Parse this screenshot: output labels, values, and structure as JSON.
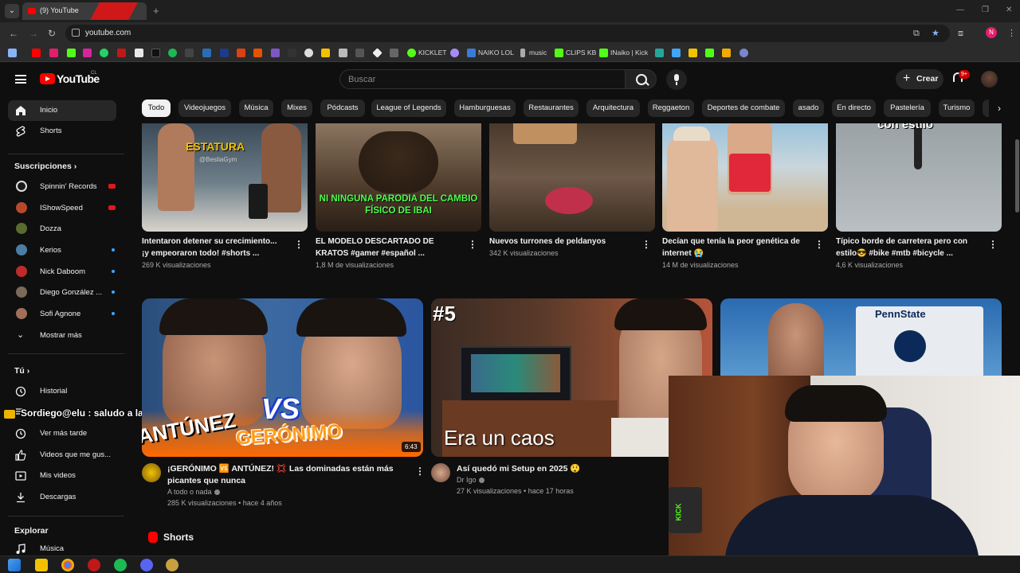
{
  "browser": {
    "tab_title": "(9) YouTube",
    "url": "youtube.com",
    "profile_initial": "N",
    "bookmarks": [
      {
        "label": "KICKLET",
        "icon": "kick-icon",
        "color": "#53fc18"
      },
      {
        "label": "NAIKO LOL",
        "icon": "bookmark-l-icon",
        "color": "#3a7bd5"
      },
      {
        "label": "music",
        "icon": "music-icon",
        "color": "#cccccc"
      },
      {
        "label": "CLIPS KB",
        "icon": "clips-icon",
        "color": "#53fc18"
      },
      {
        "label": "INaiko | Kick",
        "icon": "kick-icon",
        "color": "#53fc18"
      }
    ]
  },
  "masthead": {
    "logo_text": "YouTube",
    "country_code": "CL",
    "search_placeholder": "Buscar",
    "create_label": "Crear",
    "notifications_count": "9+"
  },
  "chips": [
    "Todo",
    "Videojuegos",
    "Música",
    "Mixes",
    "Pódcasts",
    "League of Legends",
    "Hamburguesas",
    "Restaurantes",
    "Arquitectura",
    "Reggaeton",
    "Deportes de combate",
    "asado",
    "En directo",
    "Pastelería",
    "Turismo"
  ],
  "sidebar": {
    "main": [
      {
        "label": "Inicio",
        "icon": "home-icon"
      },
      {
        "label": "Shorts",
        "icon": "shorts-icon"
      }
    ],
    "subscriptions_title": "Suscripciones",
    "subscriptions": [
      {
        "label": "Spinnin' Records",
        "color": "#1a1a1a",
        "status": "live"
      },
      {
        "label": "IShowSpeed",
        "color": "#b8482b",
        "status": "live"
      },
      {
        "label": "Dozza",
        "color": "#5a6b2e",
        "status": ""
      },
      {
        "label": "Kerios",
        "color": "#4a7ea6",
        "status": "new"
      },
      {
        "label": "Nick Daboom",
        "color": "#c02a2a",
        "status": "new"
      },
      {
        "label": "Diego González ...",
        "color": "#7a6a5a",
        "status": "new"
      },
      {
        "label": "Sofi Agnone",
        "color": "#a0705a",
        "status": "new"
      }
    ],
    "show_more": "Mostrar más",
    "you_title": "Tú",
    "you_items": [
      {
        "label": "Historial",
        "icon": "history-icon"
      },
      {
        "label": "Listas de reproducción",
        "icon": "playlist-icon"
      },
      {
        "label": "Ver más tarde",
        "icon": "watch-later-icon"
      },
      {
        "label": "Videos que me gus...",
        "icon": "like-icon"
      },
      {
        "label": "Mis videos",
        "icon": "my-videos-icon"
      },
      {
        "label": "Descargas",
        "icon": "download-icon"
      }
    ],
    "explore_title": "Explorar",
    "explore_items": [
      {
        "label": "Música",
        "icon": "music-note-icon"
      }
    ]
  },
  "chat_overlay": {
    "text": "Sordiego@elu : saludo a la alianza malenaaa"
  },
  "shorts_row": [
    {
      "title": "Intentaron detener su crecimiento... ¡y empeoraron todo! #shorts ...",
      "views": "269 K visualizaciones",
      "caption": "ESTATURA",
      "watermark": "@BestiaGym"
    },
    {
      "title": "EL MODELO DESCARTADO DE KRATOS #gamer #español ...",
      "views": "1,8 M de visualizaciones",
      "caption": "NI NINGUNA PARODIA DEL CAMBIO FÍSICO DE IBAI"
    },
    {
      "title": "Nuevos turrones de peldanyos",
      "views": "342 K visualizaciones"
    },
    {
      "title": "Decían que tenía la peor genética de internet 😭",
      "views": "14 M de visualizaciones"
    },
    {
      "title": "Típico borde de carretera pero con estilo😎 #bike #mtb #bicycle ...",
      "views": "4,6 K visualizaciones",
      "caption": "con estilo"
    }
  ],
  "videos": [
    {
      "title": "¡GERÓNIMO 🆚 ANTÚNEZ! 💢 Las dominadas están más picantes que nunca",
      "channel": "A todo o nada",
      "views": "285 K visualizaciones",
      "age": "hace 4 años",
      "duration": "6:43",
      "thumb_left": "ANTÚNEZ",
      "thumb_vs": "VS",
      "thumb_right": "GERÓNIMO"
    },
    {
      "title": "Así quedó mi Setup en 2025 😲",
      "channel": "Dr Igo",
      "views": "27 K visualizaciones",
      "age": "hace 17 horas",
      "thumb_tag": "#5",
      "thumb_caption": "Era un caos"
    },
    {
      "title": "",
      "channel": "",
      "views": "",
      "age": "",
      "thumb_sign": "PennState"
    }
  ],
  "shorts_header": "Shorts",
  "webcam": {
    "mic_sticker": "KICK"
  }
}
